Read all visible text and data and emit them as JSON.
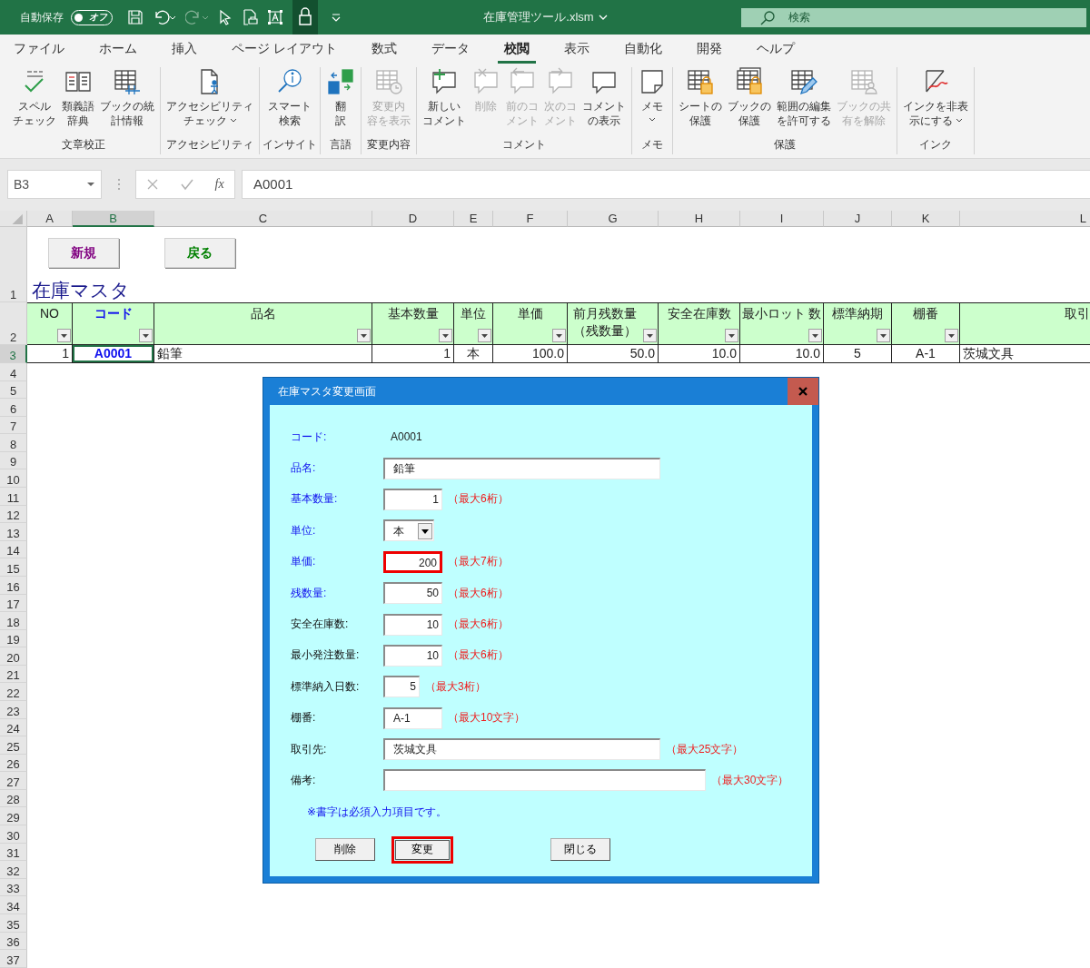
{
  "title_bar": {
    "autosave_label": "自動保存",
    "autosave_toggle": {
      "text": "オフ",
      "on": false
    },
    "file_name": "在庫管理ツール.xlsm",
    "search": {
      "placeholder": "検索"
    }
  },
  "menu_tabs": [
    {
      "label": "ファイル",
      "selected": false
    },
    {
      "label": "ホーム",
      "selected": false
    },
    {
      "label": "挿入",
      "selected": false
    },
    {
      "label": "ページ レイアウト",
      "selected": false
    },
    {
      "label": "数式",
      "selected": false
    },
    {
      "label": "データ",
      "selected": false
    },
    {
      "label": "校閲",
      "selected": true
    },
    {
      "label": "表示",
      "selected": false
    },
    {
      "label": "自動化",
      "selected": false
    },
    {
      "label": "開発",
      "selected": false
    },
    {
      "label": "ヘルプ",
      "selected": false
    }
  ],
  "ribbon_groups": [
    {
      "label": "文章校正",
      "buttons": [
        {
          "lines": [
            "スペル",
            "チェック"
          ],
          "disabled": false,
          "dropdown": false
        },
        {
          "lines": [
            "類義語",
            "辞典"
          ],
          "disabled": false,
          "dropdown": false
        },
        {
          "lines": [
            "ブックの統",
            "計情報"
          ],
          "disabled": false,
          "dropdown": false
        }
      ]
    },
    {
      "label": "アクセシビリティ",
      "buttons": [
        {
          "lines": [
            "アクセシビリティ",
            "チェック"
          ],
          "disabled": false,
          "dropdown": true
        }
      ]
    },
    {
      "label": "インサイト",
      "buttons": [
        {
          "lines": [
            "スマート",
            "検索"
          ],
          "disabled": false,
          "dropdown": false
        }
      ]
    },
    {
      "label": "言語",
      "buttons": [
        {
          "lines": [
            "翻",
            "訳"
          ],
          "disabled": false,
          "dropdown": false
        }
      ]
    },
    {
      "label": "変更内容",
      "buttons": [
        {
          "lines": [
            "変更内",
            "容を表示"
          ],
          "disabled": true,
          "dropdown": false
        }
      ]
    },
    {
      "label": "コメント",
      "buttons": [
        {
          "lines": [
            "新しい",
            "コメント"
          ],
          "disabled": false,
          "dropdown": false
        },
        {
          "lines": [
            "削除"
          ],
          "disabled": true,
          "dropdown": false
        },
        {
          "lines": [
            "前のコ",
            "メント"
          ],
          "disabled": true,
          "dropdown": false
        },
        {
          "lines": [
            "次のコ",
            "メント"
          ],
          "disabled": true,
          "dropdown": false
        },
        {
          "lines": [
            "コメント",
            "の表示"
          ],
          "disabled": false,
          "dropdown": false
        }
      ]
    },
    {
      "label": "メモ",
      "buttons": [
        {
          "lines": [
            "メモ"
          ],
          "disabled": false,
          "dropdown": true
        }
      ]
    },
    {
      "label": "保護",
      "buttons": [
        {
          "lines": [
            "シートの",
            "保護"
          ],
          "disabled": false,
          "dropdown": false
        },
        {
          "lines": [
            "ブックの",
            "保護"
          ],
          "disabled": false,
          "dropdown": false
        },
        {
          "lines": [
            "範囲の編集",
            "を許可する"
          ],
          "disabled": false,
          "dropdown": false
        },
        {
          "lines": [
            "ブックの共",
            "有を解除"
          ],
          "disabled": true,
          "dropdown": false
        }
      ]
    },
    {
      "label": "インク",
      "buttons": [
        {
          "lines": [
            "インクを非表",
            "示にする"
          ],
          "disabled": false,
          "dropdown": true
        }
      ]
    }
  ],
  "formula_bar": {
    "name_box": "B3",
    "function_label": "fx",
    "value": "A0001"
  },
  "columns": [
    {
      "letter": "A",
      "selected": false
    },
    {
      "letter": "B",
      "selected": true
    },
    {
      "letter": "C",
      "selected": false
    },
    {
      "letter": "D",
      "selected": false
    },
    {
      "letter": "E",
      "selected": false
    },
    {
      "letter": "F",
      "selected": false
    },
    {
      "letter": "G",
      "selected": false
    },
    {
      "letter": "H",
      "selected": false
    },
    {
      "letter": "I",
      "selected": false
    },
    {
      "letter": "J",
      "selected": false
    },
    {
      "letter": "K",
      "selected": false
    },
    {
      "letter": "L",
      "selected": false
    }
  ],
  "rows": [
    {
      "number": "1",
      "selected": false
    },
    {
      "number": "2",
      "selected": false
    },
    {
      "number": "3",
      "selected": true
    },
    {
      "number": "4",
      "selected": false
    },
    {
      "number": "5",
      "selected": false
    },
    {
      "number": "6",
      "selected": false
    },
    {
      "number": "7",
      "selected": false
    },
    {
      "number": "8",
      "selected": false
    },
    {
      "number": "9",
      "selected": false
    },
    {
      "number": "10",
      "selected": false
    },
    {
      "number": "11",
      "selected": false
    },
    {
      "number": "12",
      "selected": false
    },
    {
      "number": "13",
      "selected": false
    },
    {
      "number": "14",
      "selected": false
    },
    {
      "number": "15",
      "selected": false
    },
    {
      "number": "16",
      "selected": false
    },
    {
      "number": "17",
      "selected": false
    },
    {
      "number": "18",
      "selected": false
    },
    {
      "number": "19",
      "selected": false
    },
    {
      "number": "20",
      "selected": false
    },
    {
      "number": "21",
      "selected": false
    },
    {
      "number": "22",
      "selected": false
    },
    {
      "number": "23",
      "selected": false
    },
    {
      "number": "24",
      "selected": false
    },
    {
      "number": "25",
      "selected": false
    },
    {
      "number": "26",
      "selected": false
    },
    {
      "number": "27",
      "selected": false
    },
    {
      "number": "28",
      "selected": false
    },
    {
      "number": "29",
      "selected": false
    },
    {
      "number": "30",
      "selected": false
    },
    {
      "number": "31",
      "selected": false
    },
    {
      "number": "32",
      "selected": false
    },
    {
      "number": "33",
      "selected": false
    },
    {
      "number": "34",
      "selected": false
    },
    {
      "number": "35",
      "selected": false
    },
    {
      "number": "36",
      "selected": false
    },
    {
      "number": "37",
      "selected": false
    }
  ],
  "sheet": {
    "buttons": [
      {
        "label": "新規",
        "color": "#800080"
      },
      {
        "label": "戻る",
        "color": "#008000"
      }
    ],
    "title": "在庫マスタ",
    "table": {
      "headers": [
        {
          "lines": [
            "NO"
          ],
          "required": false,
          "filter": true
        },
        {
          "lines": [
            "コード"
          ],
          "required": true,
          "filter": true
        },
        {
          "lines": [
            "品名"
          ],
          "required": false,
          "filter": true
        },
        {
          "lines": [
            "基本数量"
          ],
          "required": false,
          "filter": true
        },
        {
          "lines": [
            "単位"
          ],
          "required": false,
          "filter": true
        },
        {
          "lines": [
            "単価"
          ],
          "required": false,
          "filter": true
        },
        {
          "lines": [
            "前月残数量",
            "（残数量）"
          ],
          "required": false,
          "filter": true
        },
        {
          "lines": [
            "安全在庫数"
          ],
          "required": false,
          "filter": true
        },
        {
          "lines": [
            "最小ロット 数"
          ],
          "required": false,
          "filter": true
        },
        {
          "lines": [
            "標準納期"
          ],
          "required": false,
          "filter": true
        },
        {
          "lines": [
            "棚番"
          ],
          "required": false,
          "filter": true
        },
        {
          "lines": [
            "取引"
          ],
          "required": false,
          "filter": false
        }
      ],
      "rows": [
        {
          "cells": [
            {
              "text": "1",
              "selected": false
            },
            {
              "text": "A0001",
              "selected": true
            },
            {
              "text": "鉛筆",
              "selected": false
            },
            {
              "text": "1",
              "selected": false
            },
            {
              "text": "本",
              "selected": false
            },
            {
              "text": "100.0",
              "selected": false
            },
            {
              "text": "50.0",
              "selected": false
            },
            {
              "text": "10.0",
              "selected": false
            },
            {
              "text": "10.0",
              "selected": false
            },
            {
              "text": "5",
              "selected": false
            },
            {
              "text": "A-1",
              "selected": false
            },
            {
              "text": "茨城文具",
              "selected": false
            }
          ]
        }
      ]
    }
  },
  "dialog": {
    "title": "在庫マスタ変更画面",
    "fields": [
      {
        "label": "コード:",
        "kind": "static",
        "value": "A0001",
        "required": true
      },
      {
        "label": "品名:",
        "kind": "text",
        "value": "鉛筆",
        "required": true
      },
      {
        "label": "基本数量:",
        "kind": "number",
        "value": "1",
        "required": true,
        "hint": "（最大6桁）"
      },
      {
        "label": "単位:",
        "kind": "combo",
        "value": "本",
        "required": true
      },
      {
        "label": "単価:",
        "kind": "number",
        "value": "200",
        "required": true,
        "highlighted": true,
        "hint": "（最大7桁）"
      },
      {
        "label": "残数量:",
        "kind": "number",
        "value": "50",
        "required": true,
        "hint": "（最大6桁）"
      },
      {
        "label": "安全在庫数:",
        "kind": "number",
        "value": "10",
        "required": false,
        "hint": "（最大6桁）"
      },
      {
        "label": "最小発注数量:",
        "kind": "number",
        "value": "10",
        "required": false,
        "hint": "（最大6桁）"
      },
      {
        "label": "標準納入日数:",
        "kind": "number",
        "value": "5",
        "required": false,
        "hint": "（最大3桁）"
      },
      {
        "label": "棚番:",
        "kind": "text",
        "value": "A-1",
        "required": false,
        "hint": "（最大10文字）"
      },
      {
        "label": "取引先:",
        "kind": "text",
        "value": "茨城文具",
        "required": false,
        "hint": "（最大25文字）"
      },
      {
        "label": "備考:",
        "kind": "text",
        "required": false,
        "hint": "（最大30文字）"
      }
    ],
    "note": "※書字は必須入力項目です。",
    "buttons": [
      {
        "label": "削除",
        "highlighted": false
      },
      {
        "label": "変更",
        "highlighted": true
      },
      {
        "label": "閉じる",
        "highlighted": false
      }
    ]
  }
}
